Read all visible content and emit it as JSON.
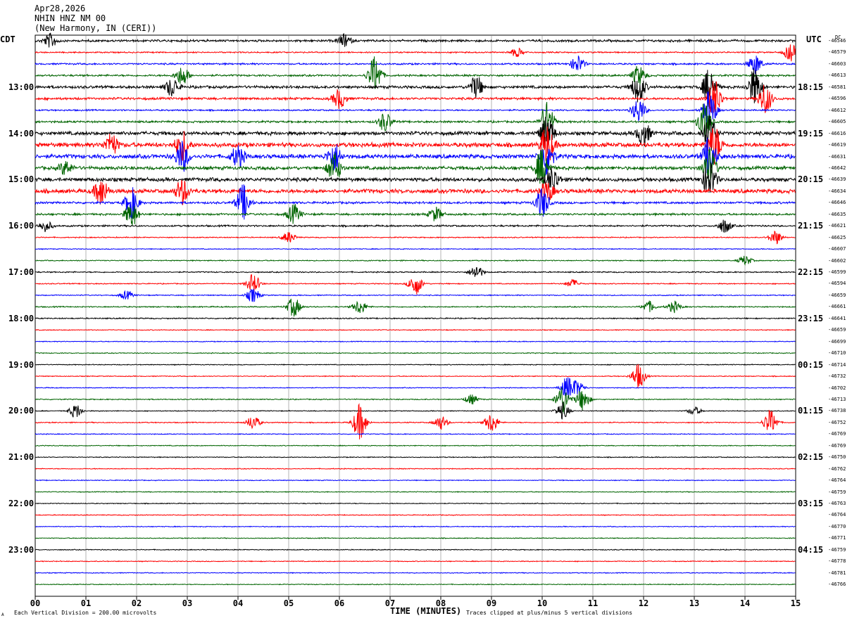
{
  "header": {
    "date": "Apr28,2026",
    "station": "NHIN HNZ NM 00",
    "location": "(New Harmony, IN (CERI))"
  },
  "left_axis_title": "CDT",
  "right_axis_title": "UTC",
  "dc_label": "DC",
  "footer": {
    "scale_note": "Each Vertical Division =  200.00 microvolts",
    "clip_note": "Traces clipped at plus/minus 5 vertical divisions",
    "corner_mark": "A"
  },
  "colors": {
    "black": "#000000",
    "red": "#ff0000",
    "blue": "#0000ff",
    "green": "#006400",
    "grid": "#808080"
  },
  "chart_data": {
    "type": "line",
    "title": "",
    "xlabel": "TIME (MINUTES)",
    "ylabel": "",
    "xlim": [
      0,
      15
    ],
    "x_ticks": [
      "00",
      "01",
      "02",
      "03",
      "04",
      "05",
      "06",
      "07",
      "08",
      "09",
      "10",
      "11",
      "12",
      "13",
      "14",
      "15"
    ],
    "grid": true,
    "trace_count": 48,
    "trace_minutes": 15,
    "trace_color_cycle": [
      "black",
      "red",
      "blue",
      "green"
    ],
    "left_hour_labels": [
      "13:00",
      "14:00",
      "15:00",
      "16:00",
      "17:00",
      "18:00",
      "19:00",
      "20:00",
      "21:00",
      "22:00",
      "23:00"
    ],
    "right_hour_labels": [
      "18:15",
      "19:15",
      "20:15",
      "21:15",
      "22:15",
      "23:15",
      "00:15",
      "01:15",
      "02:15",
      "03:15",
      "04:15"
    ],
    "hour_label_first_trace": 4,
    "dc_offsets": [
      "-46546",
      "-46579",
      "-46603",
      "-46613",
      "-46581",
      "-46596",
      "-46612",
      "-46605",
      "-46616",
      "-46619",
      "-46631",
      "-46642",
      "-46639",
      "-46634",
      "-46646",
      "-46635",
      "-46621",
      "-46625",
      "-46607",
      "-46602",
      "-46599",
      "-46594",
      "-46659",
      "-46661",
      "-46641",
      "-46659",
      "-46699",
      "-46710",
      "-46714",
      "-46732",
      "-46702",
      "-46713",
      "-46738",
      "-46752",
      "-46769",
      "-46769",
      "-46750",
      "-46762",
      "-46764",
      "-46759",
      "-46763",
      "-46764",
      "-46770",
      "-46771",
      "-46759",
      "-46778",
      "-46781",
      "-46766"
    ],
    "trace_activity": [
      1.3,
      0.8,
      1.0,
      1.1,
      1.6,
      1.4,
      0.9,
      1.2,
      2.1,
      2.6,
      2.4,
      2.0,
      2.2,
      2.4,
      1.3,
      1.2,
      1.0,
      0.6,
      0.5,
      0.6,
      0.7,
      0.6,
      0.6,
      0.7,
      0.7,
      0.5,
      0.5,
      0.5,
      0.5,
      0.5,
      0.5,
      0.6,
      0.5,
      0.6,
      0.5,
      0.5,
      0.5,
      0.5,
      0.5,
      0.5,
      0.5,
      0.5,
      0.5,
      0.5,
      0.5,
      0.5,
      0.5,
      0.5
    ],
    "events": [
      {
        "trace": 0,
        "minute": 0.3,
        "amp": 10
      },
      {
        "trace": 0,
        "minute": 6.1,
        "amp": 9
      },
      {
        "trace": 1,
        "minute": 9.5,
        "amp": 6
      },
      {
        "trace": 1,
        "minute": 14.9,
        "amp": 12
      },
      {
        "trace": 2,
        "minute": 10.7,
        "amp": 12
      },
      {
        "trace": 2,
        "minute": 14.2,
        "amp": 14
      },
      {
        "trace": 3,
        "minute": 6.7,
        "amp": 28
      },
      {
        "trace": 3,
        "minute": 2.9,
        "amp": 14
      },
      {
        "trace": 3,
        "minute": 11.9,
        "amp": 14
      },
      {
        "trace": 4,
        "minute": 2.7,
        "amp": 14
      },
      {
        "trace": 4,
        "minute": 8.7,
        "amp": 16
      },
      {
        "trace": 4,
        "minute": 11.9,
        "amp": 22
      },
      {
        "trace": 4,
        "minute": 13.3,
        "amp": 28
      },
      {
        "trace": 4,
        "minute": 14.2,
        "amp": 28
      },
      {
        "trace": 5,
        "minute": 6.0,
        "amp": 14
      },
      {
        "trace": 5,
        "minute": 13.4,
        "amp": 28
      },
      {
        "trace": 5,
        "minute": 14.4,
        "amp": 22
      },
      {
        "trace": 6,
        "minute": 13.3,
        "amp": 28
      },
      {
        "trace": 6,
        "minute": 11.9,
        "amp": 18
      },
      {
        "trace": 7,
        "minute": 6.9,
        "amp": 14
      },
      {
        "trace": 7,
        "minute": 10.1,
        "amp": 28
      },
      {
        "trace": 7,
        "minute": 13.2,
        "amp": 28
      },
      {
        "trace": 8,
        "minute": 10.1,
        "amp": 28
      },
      {
        "trace": 8,
        "minute": 13.3,
        "amp": 28
      },
      {
        "trace": 8,
        "minute": 12.0,
        "amp": 18
      },
      {
        "trace": 9,
        "minute": 1.5,
        "amp": 16
      },
      {
        "trace": 9,
        "minute": 2.9,
        "amp": 22
      },
      {
        "trace": 9,
        "minute": 10.1,
        "amp": 28
      },
      {
        "trace": 9,
        "minute": 13.4,
        "amp": 28
      },
      {
        "trace": 10,
        "minute": 2.9,
        "amp": 22
      },
      {
        "trace": 10,
        "minute": 4.0,
        "amp": 16
      },
      {
        "trace": 10,
        "minute": 5.9,
        "amp": 20
      },
      {
        "trace": 10,
        "minute": 10.1,
        "amp": 28
      },
      {
        "trace": 10,
        "minute": 13.3,
        "amp": 28
      },
      {
        "trace": 11,
        "minute": 0.6,
        "amp": 10
      },
      {
        "trace": 11,
        "minute": 5.9,
        "amp": 22
      },
      {
        "trace": 11,
        "minute": 10.0,
        "amp": 28
      },
      {
        "trace": 11,
        "minute": 13.3,
        "amp": 28
      },
      {
        "trace": 12,
        "minute": 10.2,
        "amp": 18
      },
      {
        "trace": 12,
        "minute": 13.3,
        "amp": 26
      },
      {
        "trace": 13,
        "minute": 1.3,
        "amp": 20
      },
      {
        "trace": 13,
        "minute": 2.9,
        "amp": 18
      },
      {
        "trace": 13,
        "minute": 10.1,
        "amp": 14
      },
      {
        "trace": 14,
        "minute": 1.9,
        "amp": 22
      },
      {
        "trace": 14,
        "minute": 4.1,
        "amp": 26
      },
      {
        "trace": 14,
        "minute": 10.0,
        "amp": 22
      },
      {
        "trace": 15,
        "minute": 1.9,
        "amp": 18
      },
      {
        "trace": 15,
        "minute": 5.1,
        "amp": 14
      },
      {
        "trace": 15,
        "minute": 7.9,
        "amp": 10
      },
      {
        "trace": 16,
        "minute": 0.2,
        "amp": 8
      },
      {
        "trace": 16,
        "minute": 13.6,
        "amp": 10
      },
      {
        "trace": 17,
        "minute": 5.0,
        "amp": 8
      },
      {
        "trace": 17,
        "minute": 14.6,
        "amp": 10
      },
      {
        "trace": 19,
        "minute": 14.0,
        "amp": 7
      },
      {
        "trace": 20,
        "minute": 8.7,
        "amp": 10
      },
      {
        "trace": 21,
        "minute": 4.3,
        "amp": 14
      },
      {
        "trace": 21,
        "minute": 7.5,
        "amp": 16
      },
      {
        "trace": 21,
        "minute": 10.6,
        "amp": 6
      },
      {
        "trace": 22,
        "minute": 4.3,
        "amp": 10
      },
      {
        "trace": 22,
        "minute": 1.8,
        "amp": 6
      },
      {
        "trace": 23,
        "minute": 5.1,
        "amp": 14
      },
      {
        "trace": 23,
        "minute": 6.4,
        "amp": 10
      },
      {
        "trace": 23,
        "minute": 12.1,
        "amp": 8
      },
      {
        "trace": 23,
        "minute": 12.6,
        "amp": 8
      },
      {
        "trace": 29,
        "minute": 11.9,
        "amp": 18
      },
      {
        "trace": 30,
        "minute": 10.5,
        "amp": 16
      },
      {
        "trace": 30,
        "minute": 10.7,
        "amp": 10
      },
      {
        "trace": 31,
        "minute": 10.4,
        "amp": 22
      },
      {
        "trace": 31,
        "minute": 10.8,
        "amp": 16
      },
      {
        "trace": 31,
        "minute": 8.6,
        "amp": 7
      },
      {
        "trace": 32,
        "minute": 0.8,
        "amp": 10
      },
      {
        "trace": 32,
        "minute": 10.4,
        "amp": 12
      },
      {
        "trace": 32,
        "minute": 13.0,
        "amp": 6
      },
      {
        "trace": 33,
        "minute": 6.4,
        "amp": 26
      },
      {
        "trace": 33,
        "minute": 8.0,
        "amp": 10
      },
      {
        "trace": 33,
        "minute": 9.0,
        "amp": 14
      },
      {
        "trace": 33,
        "minute": 14.5,
        "amp": 18
      },
      {
        "trace": 33,
        "minute": 4.3,
        "amp": 10
      }
    ]
  }
}
